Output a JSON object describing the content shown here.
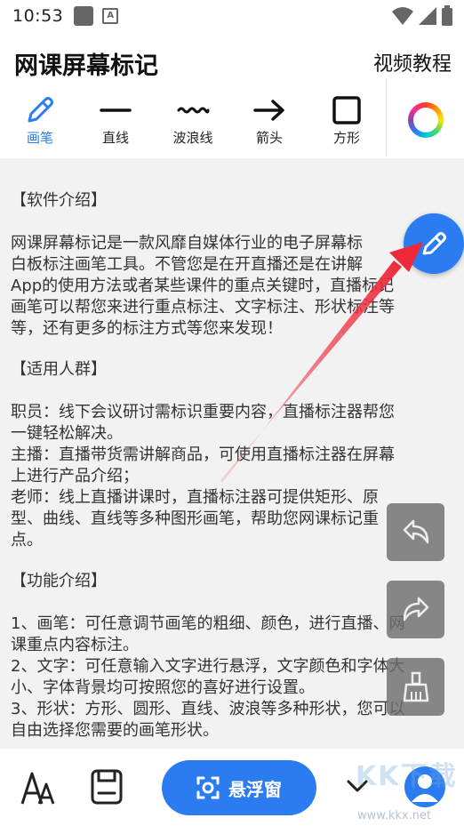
{
  "status": {
    "time": "10:53"
  },
  "header": {
    "title": "网课屏幕标记",
    "video_tutorial": "视频教程"
  },
  "tools": [
    {
      "label": "画笔",
      "icon": "pencil-icon",
      "active": true
    },
    {
      "label": "直线",
      "icon": "line-icon"
    },
    {
      "label": "波浪线",
      "icon": "wave-icon"
    },
    {
      "label": "箭头",
      "icon": "arrow-icon"
    },
    {
      "label": "方形",
      "icon": "square-icon"
    }
  ],
  "colors": {
    "accent": "#2a7cf0",
    "arrow": "#ee2a3a"
  },
  "content": {
    "intro_heading": "【软件介绍】",
    "intro_l1": "网课屏幕标记是一款风靡自媒体行业的电子屏幕标",
    "intro_l2": "白板标注画笔工具。不管您是在开直播还是在讲解",
    "intro_l3": "App的使用方法或者某些课件的重点关键时，直播标记",
    "intro_l4": "画笔可以帮您来进行重点标注、文字标注、形状标注等",
    "intro_l5": "等，还有更多的标注方式等您来发现！",
    "audience_heading": "【适用人群】",
    "aud_l1": "职员：线下会议研讨需标识重要内容，直播标注器帮您",
    "aud_l2": "一键轻松解决。",
    "aud_l3": "主播：直播带货需讲解商品，可使用直播标注器在屏幕",
    "aud_l4": "上进行产品介绍；",
    "aud_l5": "老师：线上直播讲课时，直播标注器可提供矩形、原",
    "aud_l6": "型、曲线、直线等多种图形画笔，帮助您网课标记重",
    "aud_l7": "点。",
    "features_heading": "【功能介绍】",
    "feat_l1": "1、画笔：可任意调节画笔的粗细、颜色，进行直播、网",
    "feat_l2": "课重点内容标注。",
    "feat_l3": "2、文字：可任意输入文字进行悬浮，文字颜色和字体大",
    "feat_l4": "小、字体背景均可按照您的喜好进行设置。",
    "feat_l5": "3、形状：方形、圆形、直线、波浪等多种形状，您可以",
    "feat_l6": "自由选择您需要的画笔形状。"
  },
  "bottom": {
    "float_label": "悬浮窗"
  },
  "watermark": {
    "text": "KK下载",
    "url": "www.kkx.net"
  }
}
